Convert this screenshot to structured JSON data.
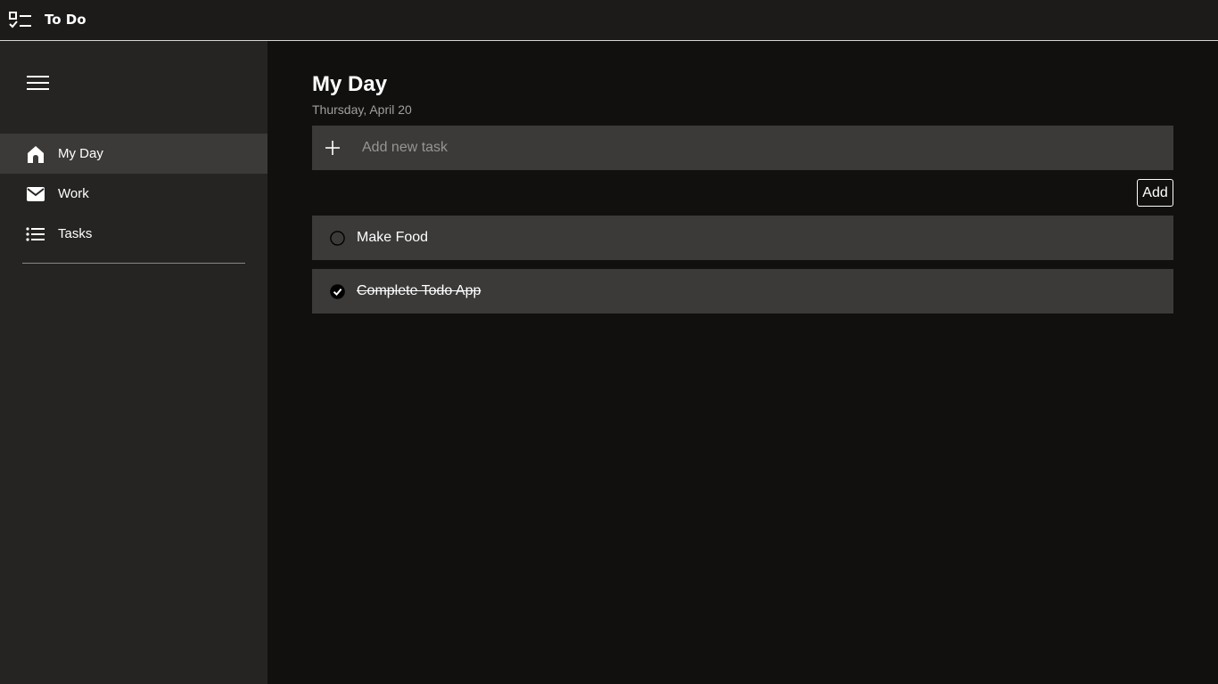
{
  "app": {
    "title": "To Do"
  },
  "sidebar": {
    "items": [
      {
        "label": "My Day",
        "icon": "home-icon",
        "active": true
      },
      {
        "label": "Work",
        "icon": "mail-icon",
        "active": false
      },
      {
        "label": "Tasks",
        "icon": "list-icon",
        "active": false
      }
    ]
  },
  "main": {
    "title": "My Day",
    "date": "Thursday, April 20",
    "add_placeholder": "Add new task",
    "add_button_label": "Add",
    "tasks": [
      {
        "text": "Make Food",
        "completed": false
      },
      {
        "text": "Complete Todo App",
        "completed": true
      }
    ]
  },
  "colors": {
    "background": "#11100f",
    "sidebar": "#252423",
    "sidebar_active": "#3b3a39",
    "task_bg": "#3b3a39",
    "titlebar": "#1c1b1a",
    "text": "#ffffff",
    "muted_text": "#a19f9d"
  }
}
